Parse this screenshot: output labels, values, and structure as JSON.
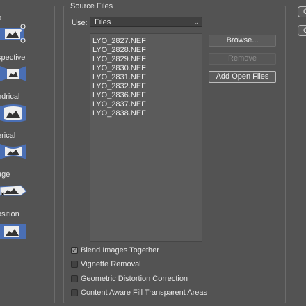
{
  "layout_panel": {
    "items": [
      {
        "label": "o",
        "icon": "auto-layout-icon"
      },
      {
        "label": "spective",
        "icon": "perspective-layout-icon"
      },
      {
        "label": "ndrical",
        "icon": "cylindrical-layout-icon"
      },
      {
        "label": "erical",
        "icon": "spherical-layout-icon"
      },
      {
        "label": "age",
        "icon": "collage-layout-icon"
      },
      {
        "label": "osition",
        "icon": "reposition-layout-icon"
      }
    ]
  },
  "source_files": {
    "title": "Source Files",
    "use_label": "Use:",
    "use_value": "Files",
    "files": [
      "LYO_2827.NEF",
      "LYO_2828.NEF",
      "LYO_2829.NEF",
      "LYO_2830.NEF",
      "LYO_2831.NEF",
      "LYO_2832.NEF",
      "LYO_2836.NEF",
      "LYO_2837.NEF",
      "LYO_2838.NEF"
    ],
    "buttons": {
      "browse": "Browse...",
      "remove": "Remove",
      "add_open_files": "Add Open Files"
    }
  },
  "options": [
    {
      "label": "Blend Images Together",
      "checked": true
    },
    {
      "label": "Vignette Removal",
      "checked": false
    },
    {
      "label": "Geometric Distortion Correction",
      "checked": false
    },
    {
      "label": "Content Aware Fill Transparent Areas",
      "checked": false
    }
  ],
  "side_buttons": [
    {
      "label": "O"
    },
    {
      "label": "C"
    }
  ],
  "colors": {
    "background": "#535353",
    "thumbnail_blue": "#4a6fb5",
    "thumbnail_white": "#eeeeee"
  }
}
